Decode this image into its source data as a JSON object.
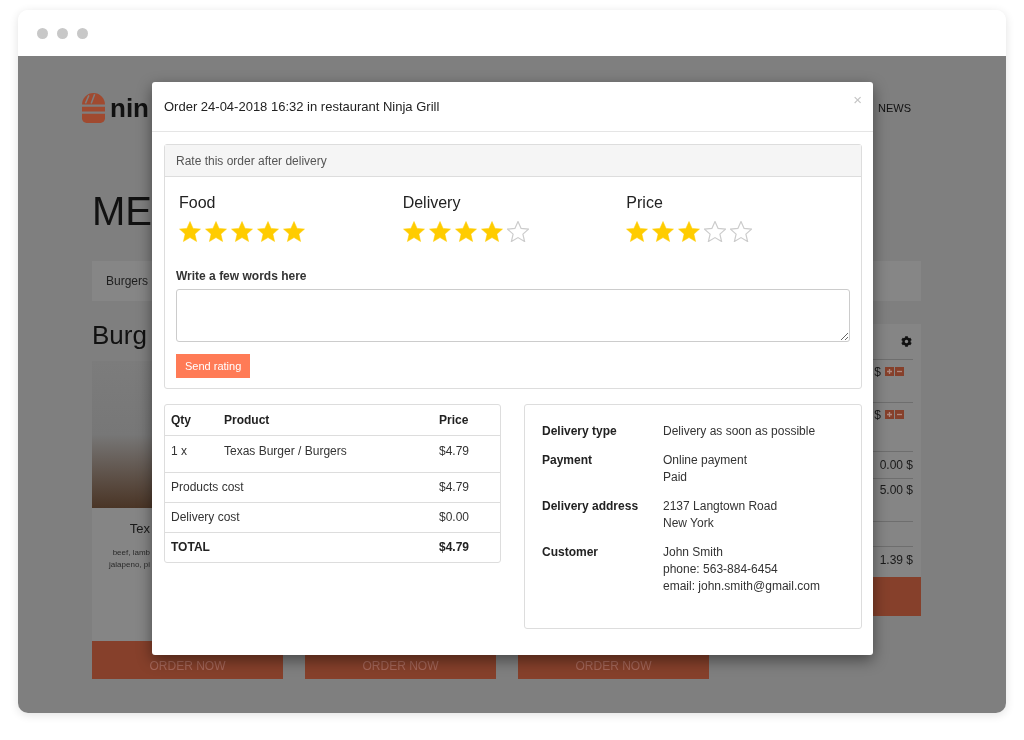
{
  "background_page": {
    "logo": {
      "text": "nin"
    },
    "nav": [
      {
        "label": "NEWS"
      }
    ],
    "heading": "ME",
    "category_tabs": [
      {
        "label": "Burgers"
      }
    ],
    "section_title": "Burg",
    "product_card": {
      "name": "Tex",
      "description": [
        "beef, lamb",
        "jalapeno, pi"
      ]
    },
    "order_buttons": [
      "ORDER NOW",
      "ORDER NOW",
      "ORDER NOW"
    ],
    "cart": {
      "items": [
        {
          "price": "$"
        },
        {
          "price": "$"
        }
      ],
      "totals": [
        "0.00 $",
        "5.00 $",
        "1.39 $"
      ]
    }
  },
  "modal": {
    "title": "Order 24-04-2018 16:32 in restaurant Ninja Grill",
    "close": "×",
    "rating": {
      "heading": "Rate this order after delivery",
      "categories": [
        {
          "label": "Food",
          "stars": 5
        },
        {
          "label": "Delivery",
          "stars": 4
        },
        {
          "label": "Price",
          "stars": 3
        }
      ],
      "comment_label": "Write a few words here",
      "submit": "Send rating"
    },
    "order_table": {
      "columns": [
        "Qty",
        "Product",
        "Price"
      ],
      "rows": [
        [
          "1 x",
          "Texas Burger / Burgers",
          "$4.79"
        ]
      ],
      "summary": [
        {
          "kind": "subtotal",
          "label": "Products cost",
          "value": "$4.79"
        },
        {
          "kind": "subtotal",
          "label": "Delivery cost",
          "value": "$0.00"
        },
        {
          "kind": "total",
          "label": "TOTAL",
          "value": "$4.79"
        }
      ]
    },
    "details": [
      {
        "label": "Delivery type",
        "lines": [
          "Delivery as soon as possible"
        ]
      },
      {
        "label": "Payment",
        "lines": [
          "Online payment",
          "Paid"
        ]
      },
      {
        "label": "Delivery address",
        "lines": [
          "2137 Langtown Road",
          "New York"
        ]
      },
      {
        "label": "Customer",
        "lines": [
          "John Smith",
          "phone: 563-884-6454",
          "email: john.smith@gmail.com"
        ]
      }
    ]
  }
}
